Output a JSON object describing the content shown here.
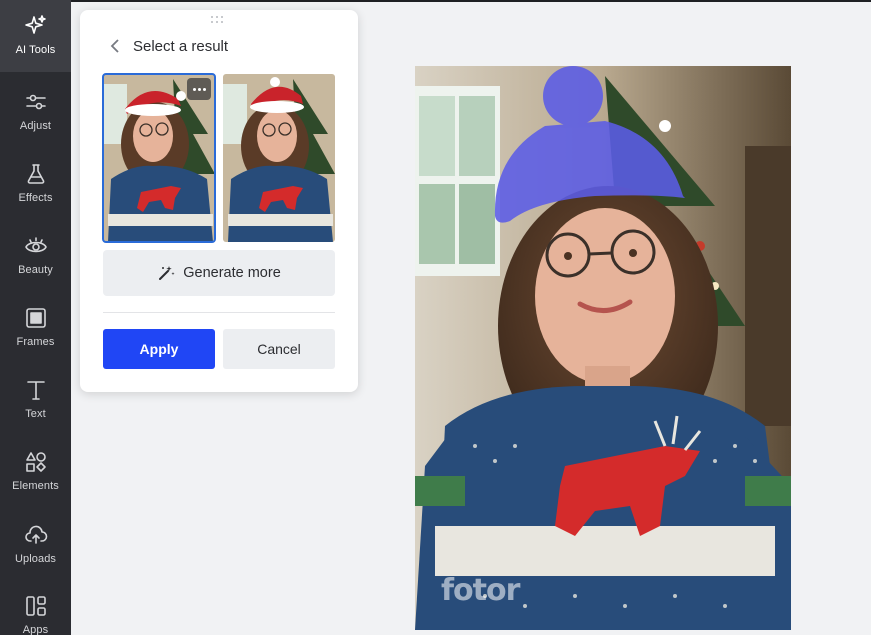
{
  "sidebar": {
    "items": [
      {
        "label": "AI Tools",
        "icon": "sparkle-icon",
        "active": true
      },
      {
        "label": "Adjust",
        "icon": "sliders-icon"
      },
      {
        "label": "Effects",
        "icon": "flask-icon"
      },
      {
        "label": "Beauty",
        "icon": "eye-icon"
      },
      {
        "label": "Frames",
        "icon": "frame-icon"
      },
      {
        "label": "Text",
        "icon": "text-icon"
      },
      {
        "label": "Elements",
        "icon": "shapes-icon"
      },
      {
        "label": "Uploads",
        "icon": "cloud-upload-icon"
      },
      {
        "label": "Apps",
        "icon": "apps-icon"
      }
    ]
  },
  "panel": {
    "title": "Select a result",
    "generate_label": "Generate more",
    "apply_label": "Apply",
    "cancel_label": "Cancel"
  },
  "canvas": {
    "watermark": "fotor"
  },
  "colors": {
    "sidebar_bg": "#2b2c31",
    "accent": "#2046f5",
    "selection": "#2a6bd8",
    "mask_overlay": "#5b5ce6"
  }
}
